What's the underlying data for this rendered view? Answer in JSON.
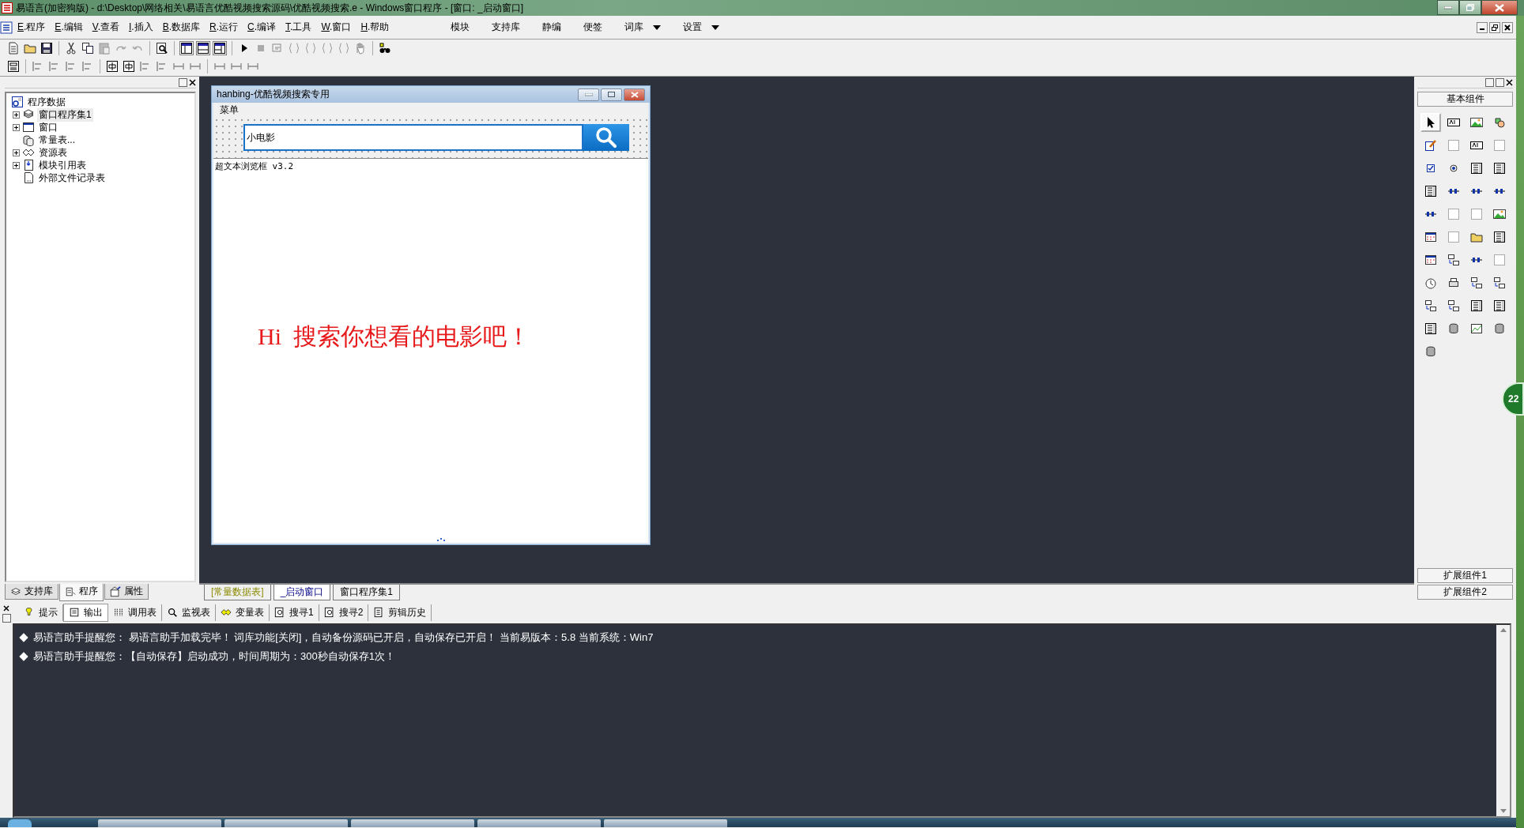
{
  "window": {
    "title": "易语言(加密狗版) - d:\\Desktop\\网络相关\\易语言优酷视频搜索源码\\优酷视频搜索.e - Windows窗口程序 - [窗口: _启动窗口]"
  },
  "menu": [
    {
      "label": "E.程序"
    },
    {
      "label": "E.编辑"
    },
    {
      "label": "V.查看"
    },
    {
      "label": "I.插入"
    },
    {
      "label": "B.数据库"
    },
    {
      "label": "R.运行"
    },
    {
      "label": "C.编译"
    },
    {
      "label": "T.工具"
    },
    {
      "label": "W.窗口"
    },
    {
      "label": "H.帮助"
    }
  ],
  "menu_right": [
    {
      "label": "模块",
      "dropdown": false
    },
    {
      "label": "支持库",
      "dropdown": false
    },
    {
      "label": "静编",
      "dropdown": false
    },
    {
      "label": "便签",
      "dropdown": false
    },
    {
      "label": "词库",
      "dropdown": true
    },
    {
      "label": "设置",
      "dropdown": true
    }
  ],
  "tree": {
    "label": "程序数据",
    "children": [
      {
        "label": "窗口程序集1",
        "expandable": true,
        "selected": true
      },
      {
        "label": "窗口",
        "expandable": true,
        "selected": false
      },
      {
        "label": "常量表...",
        "expandable": false,
        "selected": false
      },
      {
        "label": "资源表",
        "expandable": true,
        "selected": false
      },
      {
        "label": "模块引用表",
        "expandable": true,
        "selected": false
      },
      {
        "label": "外部文件记录表",
        "expandable": false,
        "selected": false
      }
    ]
  },
  "left_tabs": [
    {
      "label": "支持库",
      "selected": false
    },
    {
      "label": "程序",
      "selected": true
    },
    {
      "label": "属性",
      "selected": false
    }
  ],
  "designer": {
    "title": "hanbing-优酷视频搜索专用",
    "menu_label": "菜单",
    "search_value": "小电影",
    "browser_label": "超文本浏览框 v3.2",
    "headline": "Hi  搜索你想看的电影吧！"
  },
  "doc_tabs": [
    {
      "label": "[常量数据表]",
      "kind": "data",
      "selected": false
    },
    {
      "label": "_启动窗口",
      "kind": "window",
      "selected": true
    },
    {
      "label": "窗口程序集1",
      "kind": "code",
      "selected": false
    }
  ],
  "component_panel": {
    "title": "基本组件",
    "footers": [
      "扩展组件1",
      "扩展组件2"
    ],
    "components": [
      {
        "selected": true
      },
      {
        "selected": false
      },
      {
        "selected": false
      },
      {
        "selected": false
      },
      {
        "selected": false
      },
      {
        "selected": false
      },
      {
        "selected": false
      },
      {
        "selected": false
      },
      {
        "selected": false
      },
      {
        "selected": false
      },
      {
        "selected": false
      },
      {
        "selected": false
      },
      {
        "selected": false
      },
      {
        "selected": false
      },
      {
        "selected": false
      },
      {
        "selected": false
      },
      {
        "selected": false
      },
      {
        "selected": false
      },
      {
        "selected": false
      },
      {
        "selected": false
      },
      {
        "selected": false
      },
      {
        "selected": false
      },
      {
        "selected": false
      },
      {
        "selected": false
      },
      {
        "selected": false
      },
      {
        "selected": false
      },
      {
        "selected": false
      },
      {
        "selected": false
      },
      {
        "selected": false
      },
      {
        "selected": false
      },
      {
        "selected": false
      },
      {
        "selected": false
      },
      {
        "selected": false
      },
      {
        "selected": false
      },
      {
        "selected": false
      },
      {
        "selected": false
      },
      {
        "selected": false
      },
      {
        "selected": false
      },
      {
        "selected": false
      },
      {
        "selected": false
      },
      {
        "selected": false
      }
    ]
  },
  "output_tabs": [
    {
      "label": "提示",
      "selected": false
    },
    {
      "label": "输出",
      "selected": true
    },
    {
      "label": "调用表",
      "selected": false
    },
    {
      "label": "监视表",
      "selected": false
    },
    {
      "label": "变量表",
      "selected": false
    },
    {
      "label": "搜寻1",
      "selected": false
    },
    {
      "label": "搜寻2",
      "selected": false
    },
    {
      "label": "剪辑历史",
      "selected": false
    }
  ],
  "output_lines": [
    "易语言助手提醒您：  易语言助手加载完毕！  词库功能[关闭]，自动备份源码已开启，自动保存已开启！  当前易版本：5.8  当前系统：Win7",
    "易语言助手提醒您：【自动保存】启动成功，时间周期为：300秒自动保存1次！"
  ],
  "desktop_widget": {
    "label": "22"
  }
}
